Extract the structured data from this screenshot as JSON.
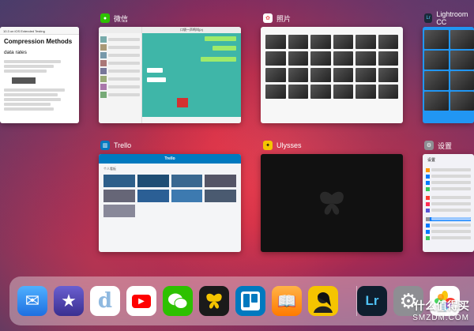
{
  "cards": {
    "left_doc": {
      "heading1": "Compression Methods",
      "heading2": "data rates",
      "top_line": "10.3 on iOS Extended Testing"
    },
    "wechat": {
      "label": "微信",
      "icon_color": "#2dc100",
      "chat_title": "口袋一声鸣叫(≥)"
    },
    "photos": {
      "label": "照片",
      "icon_color": "#f5f5f5"
    },
    "lightroom": {
      "label": "Lightroom CC",
      "icon_color": "#1b2a3a",
      "icon_text": "Lr"
    },
    "trello": {
      "label": "Trello",
      "icon_color": "#0079bf",
      "header_text": "Trello",
      "board_label": "个人看板"
    },
    "ulysses": {
      "label": "Ulysses",
      "icon_color": "#1a1a1a"
    },
    "settings": {
      "label": "设置",
      "icon_color": "#8e8e93",
      "title": "设置"
    }
  },
  "dock": {
    "apps": [
      {
        "name": "mail-app",
        "color": "#1e88e5",
        "glyph": "✉"
      },
      {
        "name": "imovie-app",
        "color": "#4a3fb0",
        "glyph": "★"
      },
      {
        "name": "keynote-style-app",
        "color": "#ffffff",
        "glyph": "d"
      },
      {
        "name": "youtube-app",
        "color": "#ffffff",
        "glyph": "▶"
      },
      {
        "name": "wechat-app",
        "color": "#2dc100",
        "glyph": "💬"
      },
      {
        "name": "ulysses-app",
        "color": "#1a1a1a",
        "glyph": "🦋"
      },
      {
        "name": "trello-app",
        "color": "#0079bf",
        "glyph": "▥"
      },
      {
        "name": "books-app",
        "color": "#ff8a00",
        "glyph": "📖"
      },
      {
        "name": "portrait-app",
        "color": "#f5c400",
        "glyph": "👤"
      },
      {
        "name": "lightroom-app",
        "color": "#0e1e2e",
        "glyph": "Lr"
      },
      {
        "name": "settings-app",
        "color": "#8e8e93",
        "glyph": "⚙"
      },
      {
        "name": "photos-app",
        "color": "#ffffff",
        "glyph": "✿"
      }
    ]
  },
  "watermark": {
    "chinese": "什么值得买",
    "latin": "SMZDM.COM"
  }
}
